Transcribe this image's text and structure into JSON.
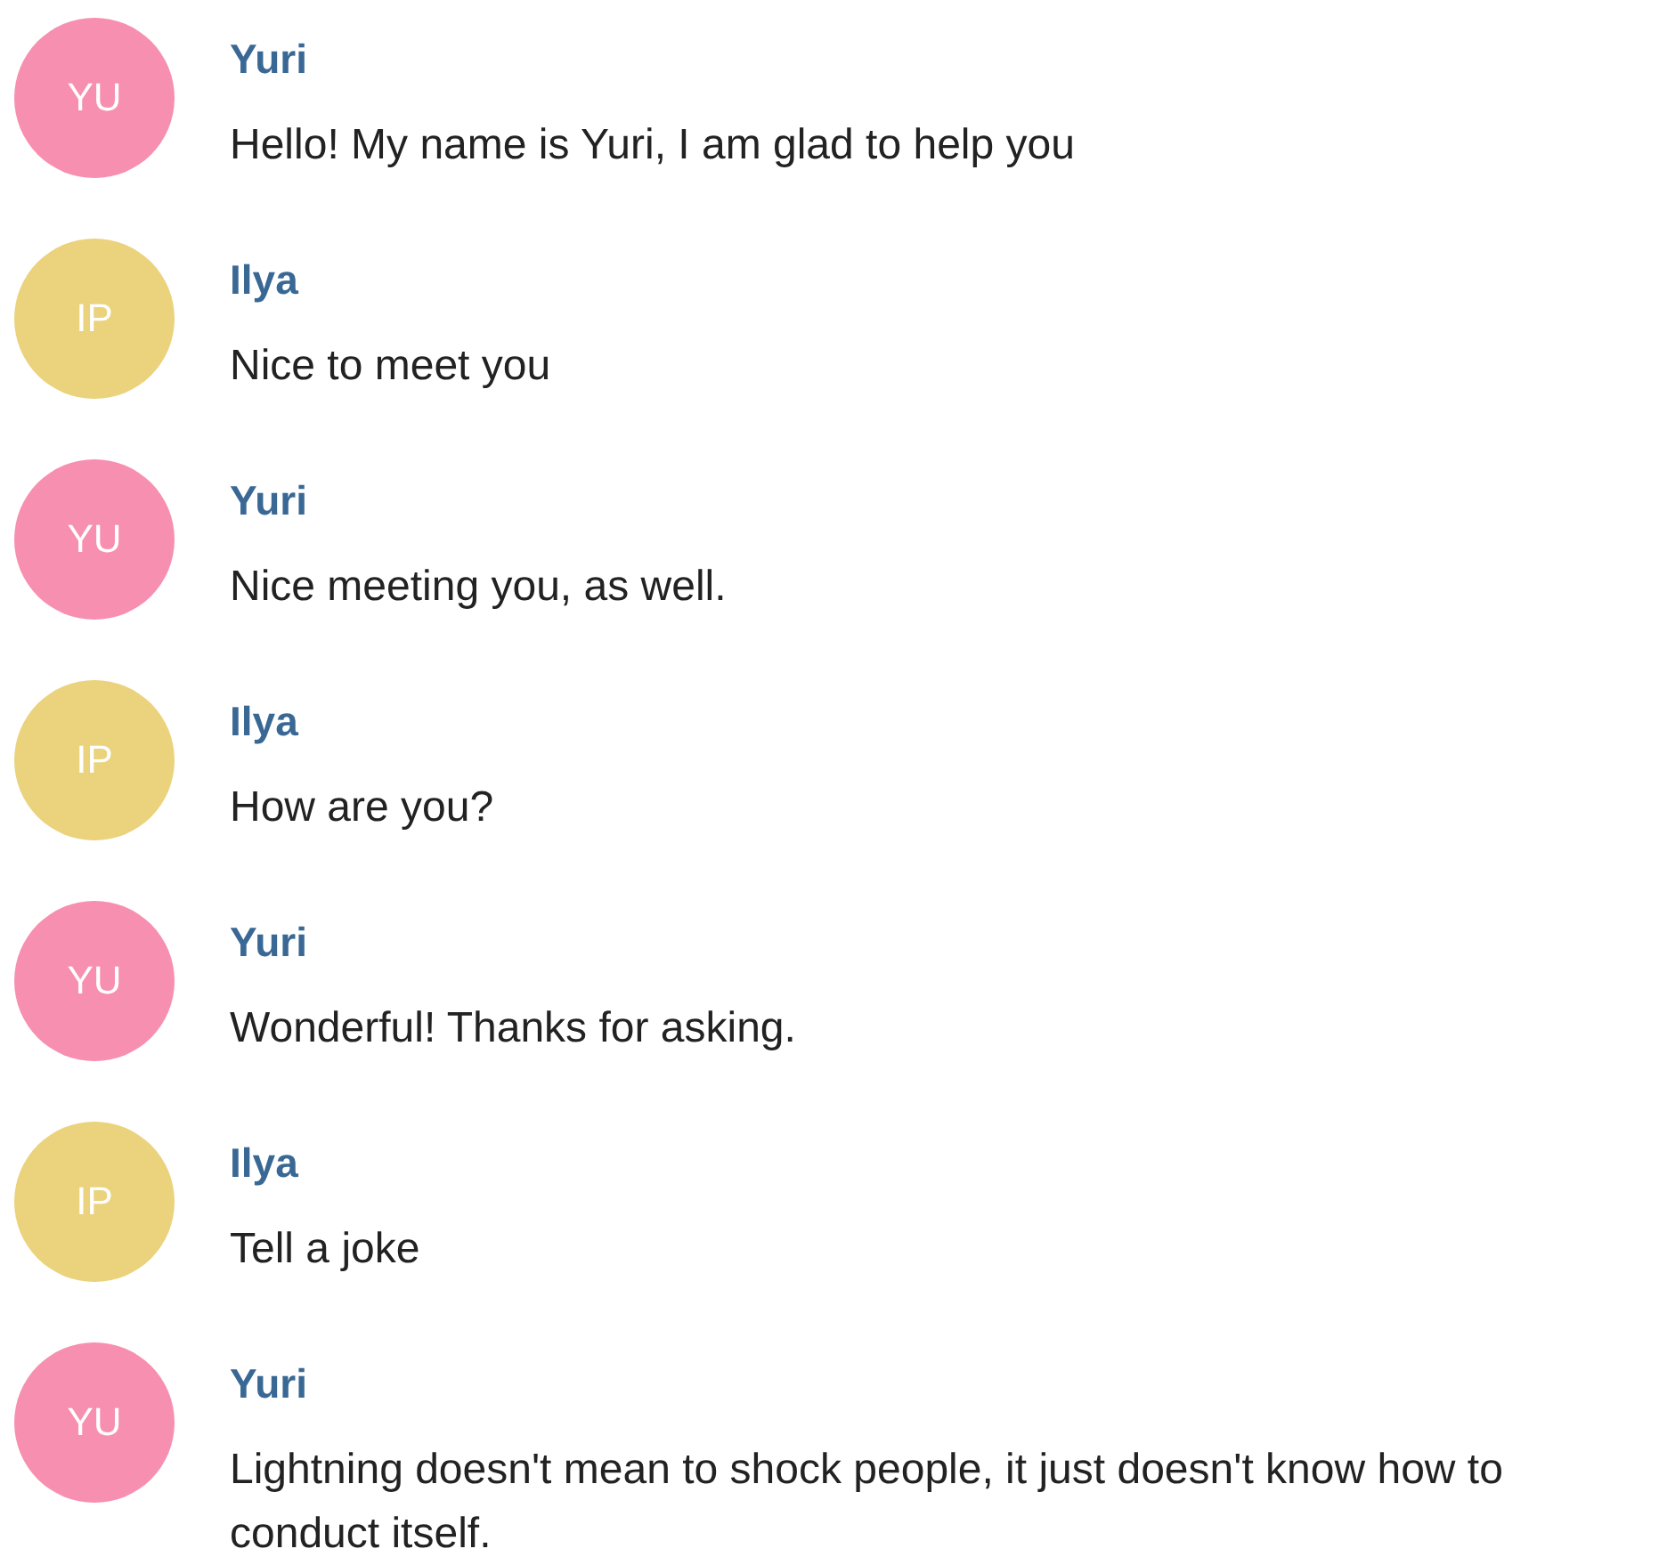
{
  "messages": [
    {
      "initials": "YU",
      "color": "#f78fb0",
      "author": "Yuri",
      "text": "Hello! My name is Yuri, I am glad to help you"
    },
    {
      "initials": "IP",
      "color": "#ebd27c",
      "author": "Ilya",
      "text": "Nice to meet you"
    },
    {
      "initials": "YU",
      "color": "#f78fb0",
      "author": "Yuri",
      "text": "Nice meeting you, as well."
    },
    {
      "initials": "IP",
      "color": "#ebd27c",
      "author": "Ilya",
      "text": "How are you?"
    },
    {
      "initials": "YU",
      "color": "#f78fb0",
      "author": "Yuri",
      "text": "Wonderful! Thanks for asking."
    },
    {
      "initials": "IP",
      "color": "#ebd27c",
      "author": "Ilya",
      "text": "Tell a joke"
    },
    {
      "initials": "YU",
      "color": "#f78fb0",
      "author": "Yuri",
      "text": "Lightning doesn't mean to shock people, it just doesn't know how to conduct itself."
    }
  ]
}
